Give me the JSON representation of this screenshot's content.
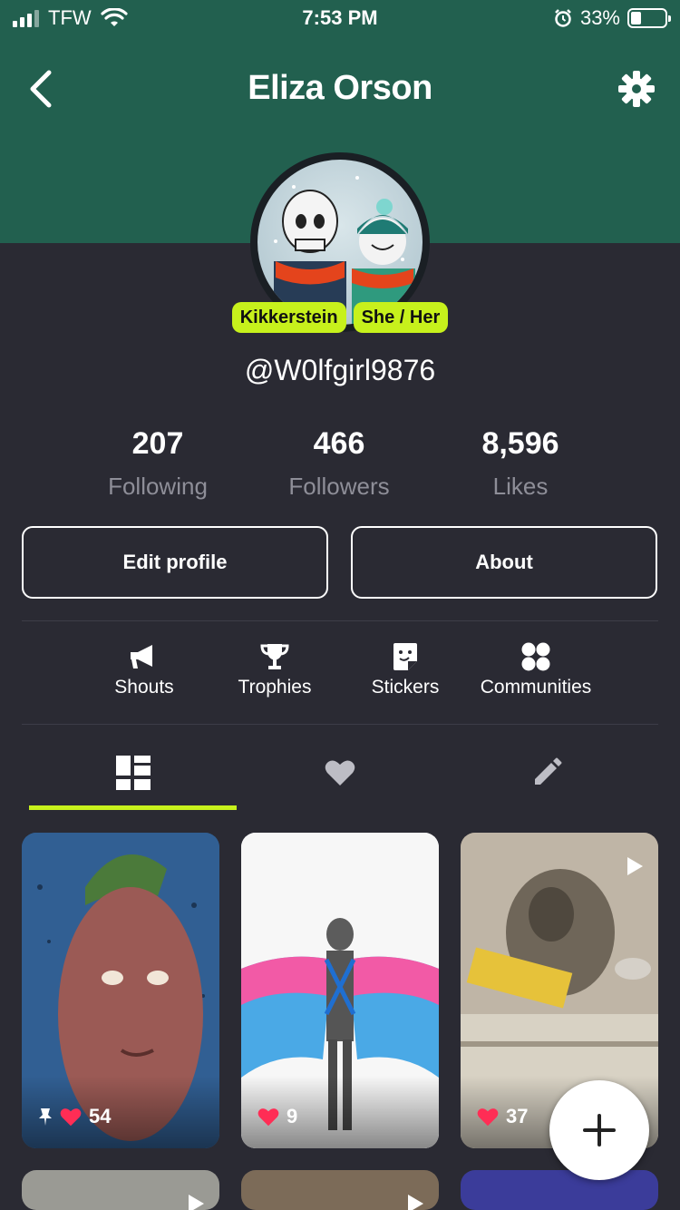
{
  "status_bar": {
    "carrier": "TFW",
    "time": "7:53 PM",
    "battery": "33%"
  },
  "header": {
    "title": "Eliza Orson"
  },
  "profile": {
    "badges": [
      "Kikkerstein",
      "She / Her"
    ],
    "username": "@W0lfgirl9876"
  },
  "stats": [
    {
      "value": "207",
      "label": "Following"
    },
    {
      "value": "466",
      "label": "Followers"
    },
    {
      "value": "8,596",
      "label": "Likes"
    }
  ],
  "buttons": {
    "edit": "Edit profile",
    "about": "About"
  },
  "menu": [
    {
      "label": "Shouts",
      "icon": "megaphone-icon"
    },
    {
      "label": "Trophies",
      "icon": "trophy-icon"
    },
    {
      "label": "Stickers",
      "icon": "sticker-icon"
    },
    {
      "label": "Communities",
      "icon": "communities-icon"
    }
  ],
  "tabs": [
    {
      "icon": "grid-icon",
      "active": true
    },
    {
      "icon": "heart-icon",
      "active": false
    },
    {
      "icon": "pencil-icon",
      "active": false
    }
  ],
  "posts": [
    {
      "likes": "54",
      "pinned": true,
      "video": false
    },
    {
      "likes": "9",
      "pinned": false,
      "video": false
    },
    {
      "likes": "37",
      "pinned": false,
      "video": true
    }
  ],
  "colors": {
    "header": "#22604f",
    "background": "#2a2a33",
    "accent": "#c7f11c",
    "heart": "#ff2d55"
  }
}
